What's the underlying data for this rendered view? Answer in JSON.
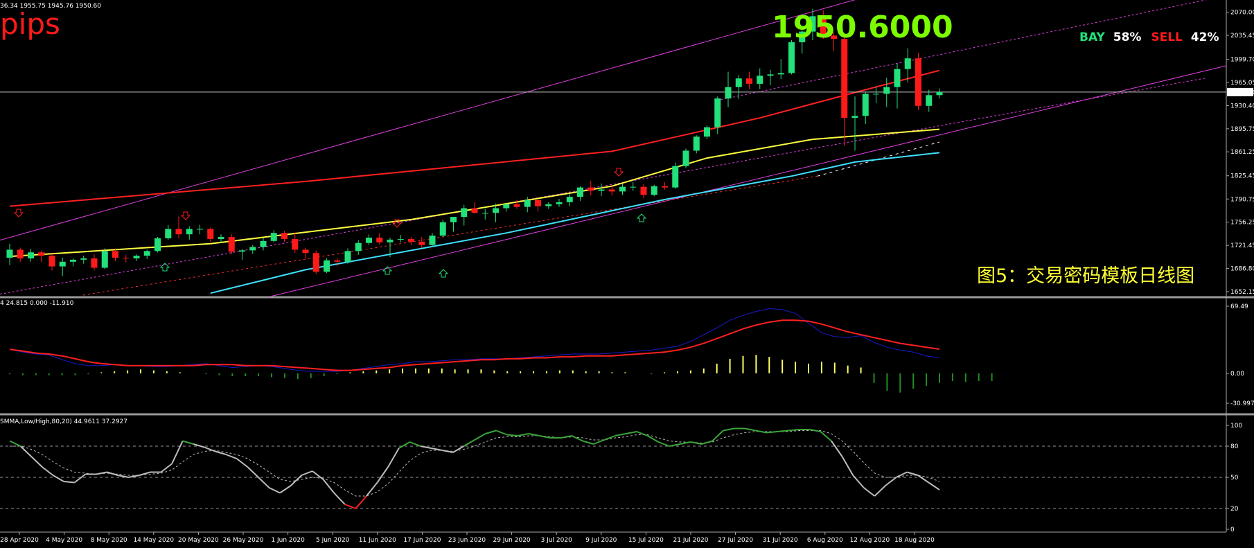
{
  "header": {
    "ohlc_text": "36.34 1955.75 1945.76 1950.60",
    "pips_text": "pips",
    "big_price": "1950.6000",
    "bay_label": "BAY",
    "bay_pct": "58%",
    "sell_label": "SELL",
    "sell_pct": "42%",
    "caption": "图5：交易密码模板日线图"
  },
  "colors": {
    "bull": "#22e07a",
    "bear": "#ff1a1a",
    "price_line_label_bg": "#ffffff",
    "ma_red": "#ff2020",
    "ma_yellow": "#ffff40",
    "ma_cyan": "#40e0ff",
    "channel": "#e040e0",
    "macd_blue": "#1a1ad0",
    "macd_red": "#ff2020",
    "hist_pos": "#ffff66",
    "hist_neg": "#1f8f1f",
    "stoch_gray": "#bdbdbd",
    "stoch_green": "#3aa53a",
    "stoch_red": "#ff2020",
    "caption": "#ffff33",
    "big_price": "#7cfc00"
  },
  "panels": {
    "macd_info": "4 24.815 0.000 -11.910",
    "stoch_info": "SMMA,Low/High,80,20) 44.9611 37.2927"
  },
  "chart_data": [
    {
      "type": "candlestick",
      "title": "",
      "current_price": 1950.6,
      "ylim": [
        1645,
        2082
      ],
      "y_ticks": [
        "2070.00",
        "2035.45",
        "1999.70",
        "1965.05",
        "1930.40",
        "1895.75",
        "1861.25",
        "1825.45",
        "1790.75",
        "1756.25",
        "1721.45",
        "1686.80",
        "1652.15"
      ],
      "x_labels": [
        "28 Apr 2020",
        "4 May 2020",
        "8 May 2020",
        "14 May 2020",
        "20 May 2020",
        "26 May 2020",
        "1 Jun 2020",
        "5 Jun 2020",
        "11 Jun 2020",
        "17 Jun 2020",
        "23 Jun 2020",
        "29 Jun 2020",
        "3 Jul 2020",
        "9 Jul 2020",
        "15 Jul 2020",
        "21 Jul 2020",
        "27 Jul 2020",
        "31 Jul 2020",
        "6 Aug 2020",
        "12 Aug 2020",
        "18 Aug 2020"
      ],
      "candles": [
        {
          "o": 1703,
          "h": 1724,
          "l": 1692,
          "c": 1715
        },
        {
          "o": 1715,
          "h": 1718,
          "l": 1697,
          "c": 1702
        },
        {
          "o": 1702,
          "h": 1716,
          "l": 1697,
          "c": 1711
        },
        {
          "o": 1711,
          "h": 1714,
          "l": 1696,
          "c": 1706
        },
        {
          "o": 1706,
          "h": 1709,
          "l": 1684,
          "c": 1690
        },
        {
          "o": 1690,
          "h": 1703,
          "l": 1676,
          "c": 1697
        },
        {
          "o": 1697,
          "h": 1702,
          "l": 1690,
          "c": 1700
        },
        {
          "o": 1700,
          "h": 1706,
          "l": 1694,
          "c": 1702
        },
        {
          "o": 1702,
          "h": 1708,
          "l": 1684,
          "c": 1688
        },
        {
          "o": 1688,
          "h": 1717,
          "l": 1686,
          "c": 1713
        },
        {
          "o": 1713,
          "h": 1717,
          "l": 1698,
          "c": 1703
        },
        {
          "o": 1703,
          "h": 1707,
          "l": 1696,
          "c": 1702
        },
        {
          "o": 1702,
          "h": 1708,
          "l": 1698,
          "c": 1706
        },
        {
          "o": 1706,
          "h": 1715,
          "l": 1701,
          "c": 1713
        },
        {
          "o": 1713,
          "h": 1734,
          "l": 1711,
          "c": 1732
        },
        {
          "o": 1732,
          "h": 1752,
          "l": 1730,
          "c": 1746
        },
        {
          "o": 1746,
          "h": 1765,
          "l": 1732,
          "c": 1738
        },
        {
          "o": 1738,
          "h": 1750,
          "l": 1730,
          "c": 1746
        },
        {
          "o": 1746,
          "h": 1752,
          "l": 1738,
          "c": 1746
        },
        {
          "o": 1746,
          "h": 1748,
          "l": 1727,
          "c": 1731
        },
        {
          "o": 1731,
          "h": 1738,
          "l": 1726,
          "c": 1734
        },
        {
          "o": 1734,
          "h": 1738,
          "l": 1708,
          "c": 1712
        },
        {
          "o": 1712,
          "h": 1716,
          "l": 1700,
          "c": 1714
        },
        {
          "o": 1714,
          "h": 1722,
          "l": 1709,
          "c": 1719
        },
        {
          "o": 1719,
          "h": 1733,
          "l": 1714,
          "c": 1728
        },
        {
          "o": 1728,
          "h": 1744,
          "l": 1726,
          "c": 1740
        },
        {
          "o": 1740,
          "h": 1743,
          "l": 1727,
          "c": 1731
        },
        {
          "o": 1731,
          "h": 1741,
          "l": 1710,
          "c": 1715
        },
        {
          "o": 1715,
          "h": 1718,
          "l": 1702,
          "c": 1710
        },
        {
          "o": 1710,
          "h": 1714,
          "l": 1678,
          "c": 1682
        },
        {
          "o": 1682,
          "h": 1702,
          "l": 1680,
          "c": 1699
        },
        {
          "o": 1699,
          "h": 1702,
          "l": 1690,
          "c": 1697
        },
        {
          "o": 1697,
          "h": 1717,
          "l": 1694,
          "c": 1713
        },
        {
          "o": 1713,
          "h": 1729,
          "l": 1707,
          "c": 1725
        },
        {
          "o": 1725,
          "h": 1738,
          "l": 1722,
          "c": 1733
        },
        {
          "o": 1733,
          "h": 1740,
          "l": 1723,
          "c": 1726
        },
        {
          "o": 1726,
          "h": 1733,
          "l": 1704,
          "c": 1730
        },
        {
          "o": 1730,
          "h": 1737,
          "l": 1726,
          "c": 1731
        },
        {
          "o": 1731,
          "h": 1734,
          "l": 1722,
          "c": 1727
        },
        {
          "o": 1727,
          "h": 1734,
          "l": 1718,
          "c": 1722
        },
        {
          "o": 1722,
          "h": 1740,
          "l": 1720,
          "c": 1736
        },
        {
          "o": 1736,
          "h": 1760,
          "l": 1734,
          "c": 1756
        },
        {
          "o": 1756,
          "h": 1764,
          "l": 1742,
          "c": 1764
        },
        {
          "o": 1764,
          "h": 1782,
          "l": 1751,
          "c": 1777
        },
        {
          "o": 1777,
          "h": 1786,
          "l": 1769,
          "c": 1770
        },
        {
          "o": 1770,
          "h": 1776,
          "l": 1760,
          "c": 1770
        },
        {
          "o": 1770,
          "h": 1784,
          "l": 1756,
          "c": 1777
        },
        {
          "o": 1777,
          "h": 1783,
          "l": 1772,
          "c": 1783
        },
        {
          "o": 1783,
          "h": 1789,
          "l": 1776,
          "c": 1779
        },
        {
          "o": 1779,
          "h": 1794,
          "l": 1771,
          "c": 1789
        },
        {
          "o": 1789,
          "h": 1791,
          "l": 1772,
          "c": 1780
        },
        {
          "o": 1780,
          "h": 1786,
          "l": 1776,
          "c": 1783
        },
        {
          "o": 1783,
          "h": 1791,
          "l": 1779,
          "c": 1786
        },
        {
          "o": 1786,
          "h": 1798,
          "l": 1780,
          "c": 1794
        },
        {
          "o": 1794,
          "h": 1810,
          "l": 1788,
          "c": 1808
        },
        {
          "o": 1808,
          "h": 1818,
          "l": 1796,
          "c": 1803
        },
        {
          "o": 1803,
          "h": 1814,
          "l": 1795,
          "c": 1805
        },
        {
          "o": 1805,
          "h": 1810,
          "l": 1796,
          "c": 1802
        },
        {
          "o": 1802,
          "h": 1813,
          "l": 1797,
          "c": 1809
        },
        {
          "o": 1809,
          "h": 1816,
          "l": 1803,
          "c": 1809
        },
        {
          "o": 1809,
          "h": 1813,
          "l": 1792,
          "c": 1797
        },
        {
          "o": 1797,
          "h": 1812,
          "l": 1795,
          "c": 1810
        },
        {
          "o": 1810,
          "h": 1816,
          "l": 1805,
          "c": 1808
        },
        {
          "o": 1808,
          "h": 1845,
          "l": 1806,
          "c": 1840
        },
        {
          "o": 1840,
          "h": 1866,
          "l": 1837,
          "c": 1863
        },
        {
          "o": 1863,
          "h": 1886,
          "l": 1859,
          "c": 1884
        },
        {
          "o": 1884,
          "h": 1901,
          "l": 1880,
          "c": 1898
        },
        {
          "o": 1898,
          "h": 1944,
          "l": 1888,
          "c": 1941
        },
        {
          "o": 1941,
          "h": 1981,
          "l": 1928,
          "c": 1958
        },
        {
          "o": 1958,
          "h": 1976,
          "l": 1940,
          "c": 1971
        },
        {
          "o": 1971,
          "h": 1981,
          "l": 1955,
          "c": 1963
        },
        {
          "o": 1963,
          "h": 1986,
          "l": 1955,
          "c": 1975
        },
        {
          "o": 1975,
          "h": 1984,
          "l": 1961,
          "c": 1977
        },
        {
          "o": 1977,
          "h": 2000,
          "l": 1970,
          "c": 1979
        },
        {
          "o": 1979,
          "h": 2028,
          "l": 1977,
          "c": 2025
        },
        {
          "o": 2025,
          "h": 2043,
          "l": 2008,
          "c": 2041
        },
        {
          "o": 2041,
          "h": 2075,
          "l": 2028,
          "c": 2064
        },
        {
          "o": 2064,
          "h": 2073,
          "l": 2030,
          "c": 2035
        },
        {
          "o": 2035,
          "h": 2040,
          "l": 2012,
          "c": 2030
        },
        {
          "o": 2030,
          "h": 2032,
          "l": 1870,
          "c": 1912
        },
        {
          "o": 1912,
          "h": 1944,
          "l": 1863,
          "c": 1915
        },
        {
          "o": 1915,
          "h": 1950,
          "l": 1903,
          "c": 1948
        },
        {
          "o": 1948,
          "h": 1959,
          "l": 1934,
          "c": 1948
        },
        {
          "o": 1948,
          "h": 1972,
          "l": 1928,
          "c": 1958
        },
        {
          "o": 1958,
          "h": 1993,
          "l": 1926,
          "c": 1985
        },
        {
          "o": 1985,
          "h": 2016,
          "l": 1965,
          "c": 2001
        },
        {
          "o": 2001,
          "h": 2009,
          "l": 1924,
          "c": 1930
        },
        {
          "o": 1930,
          "h": 1954,
          "l": 1921,
          "c": 1946
        },
        {
          "o": 1946,
          "h": 1956,
          "l": 1941,
          "c": 1950.6
        }
      ],
      "overlays": {
        "ma_red": [
          [
            1780,
            0
          ],
          [
            1817,
            30
          ],
          [
            1862,
            60
          ],
          [
            1912,
            75
          ],
          [
            1950,
            85
          ],
          [
            1983,
            93
          ]
        ],
        "ma_yellow": [
          [
            1705,
            0
          ],
          [
            1724,
            20
          ],
          [
            1760,
            40
          ],
          [
            1810,
            60
          ],
          [
            1852,
            70
          ],
          [
            1880,
            80
          ],
          [
            1895,
            93
          ]
        ],
        "ma_cyan": [
          [
            1650,
            20
          ],
          [
            1685,
            30
          ],
          [
            1740,
            50
          ],
          [
            1790,
            65
          ],
          [
            1825,
            78
          ],
          [
            1846,
            85
          ],
          [
            1860,
            93
          ]
        ]
      }
    },
    {
      "type": "line",
      "title": "",
      "ylim": [
        -30.997,
        69.49
      ],
      "y_ticks": [
        "69.49",
        "0.00",
        "-30.997"
      ],
      "series": [
        {
          "name": "",
          "color": "blue",
          "values": [
            24.8,
            22,
            20,
            19,
            14,
            10,
            8,
            8,
            9,
            8,
            8,
            7,
            7,
            8,
            9,
            10,
            8,
            6,
            7,
            8,
            7,
            5,
            3,
            2,
            2,
            2,
            3,
            5,
            7,
            9,
            10,
            12,
            12,
            13,
            14,
            14,
            15,
            15,
            15,
            16,
            17,
            18,
            19,
            20,
            20,
            20,
            21,
            22,
            23,
            24,
            26,
            28,
            33,
            40,
            47,
            55,
            60,
            64,
            67,
            66,
            62,
            52,
            42,
            38,
            37,
            39,
            32,
            27,
            24,
            22,
            18,
            16
          ]
        },
        {
          "name": "",
          "color": "red",
          "values": [
            24.8,
            23,
            21,
            20,
            18,
            15,
            12,
            10,
            9,
            8,
            8,
            8,
            8,
            8,
            8,
            9,
            9,
            9,
            8,
            8,
            8,
            7,
            6,
            5,
            4,
            3,
            3,
            4,
            5,
            6,
            8,
            9,
            10,
            11,
            12,
            13,
            14,
            14,
            15,
            15,
            16,
            16,
            17,
            17,
            18,
            18,
            18,
            19,
            20,
            21,
            22,
            24,
            27,
            31,
            36,
            41,
            46,
            50,
            53,
            55,
            55,
            54,
            51,
            47,
            43,
            40,
            37,
            34,
            31,
            29,
            27,
            25
          ]
        },
        {
          "name": "",
          "type": "histogram",
          "values": [
            -1,
            -2,
            -2,
            -2,
            -2,
            -2,
            -1,
            1,
            2,
            3,
            4,
            3,
            2,
            1,
            0,
            -1,
            -2,
            -3,
            -3,
            -3,
            -4,
            -5,
            -6,
            -5,
            -3,
            -1,
            1,
            2,
            3,
            4,
            5,
            5,
            5,
            5,
            4,
            4,
            4,
            3,
            2,
            2,
            2,
            2,
            3,
            3,
            2,
            2,
            1,
            1,
            0,
            -1,
            1,
            2,
            3,
            5,
            10,
            15,
            18,
            19,
            17,
            14,
            12,
            10,
            12,
            11,
            8,
            6,
            -10,
            -18,
            -20,
            -16,
            -13,
            -10,
            -8,
            -9,
            -8,
            -8
          ]
        }
      ]
    },
    {
      "type": "line",
      "title": "",
      "ylim": [
        0,
        100
      ],
      "y_ticks": [
        "100",
        "80",
        "50",
        "20",
        "0"
      ],
      "series": [
        {
          "name": "",
          "color": "gray",
          "values": [
            85,
            80,
            70,
            60,
            52,
            46,
            45,
            53,
            53,
            55,
            52,
            50,
            52,
            55,
            55,
            63,
            85,
            82,
            79,
            75,
            72,
            68,
            60,
            50,
            40,
            35,
            42,
            52,
            56,
            48,
            35,
            24,
            20,
            32,
            45,
            60,
            78,
            84,
            80,
            78,
            76,
            74,
            80,
            86,
            92,
            95,
            91,
            90,
            92,
            90,
            88,
            88,
            90,
            85,
            82,
            86,
            90,
            92,
            94,
            90,
            84,
            80,
            82,
            84,
            82,
            85,
            95,
            97,
            97,
            95,
            93,
            94,
            95,
            96,
            96,
            94,
            85,
            70,
            52,
            40,
            32,
            42,
            50,
            55,
            52,
            45,
            38
          ]
        },
        {
          "name": "",
          "color": "gray-dashed",
          "values": [
            80,
            80,
            77,
            72,
            65,
            59,
            55,
            54,
            53,
            54,
            53,
            52,
            52,
            53,
            54,
            57,
            65,
            72,
            75,
            76,
            74,
            72,
            68,
            62,
            55,
            48,
            46,
            48,
            50,
            49,
            45,
            38,
            32,
            32,
            36,
            44,
            55,
            66,
            73,
            76,
            76,
            75,
            77,
            80,
            84,
            88,
            89,
            89,
            90,
            90,
            89,
            88,
            89,
            88,
            86,
            86,
            88,
            89,
            91,
            91,
            88,
            85,
            84,
            84,
            83,
            84,
            88,
            91,
            93,
            94,
            94,
            94,
            94,
            95,
            95,
            95,
            92,
            85,
            75,
            64,
            54,
            50,
            50,
            52,
            52,
            50,
            46
          ]
        }
      ]
    }
  ]
}
